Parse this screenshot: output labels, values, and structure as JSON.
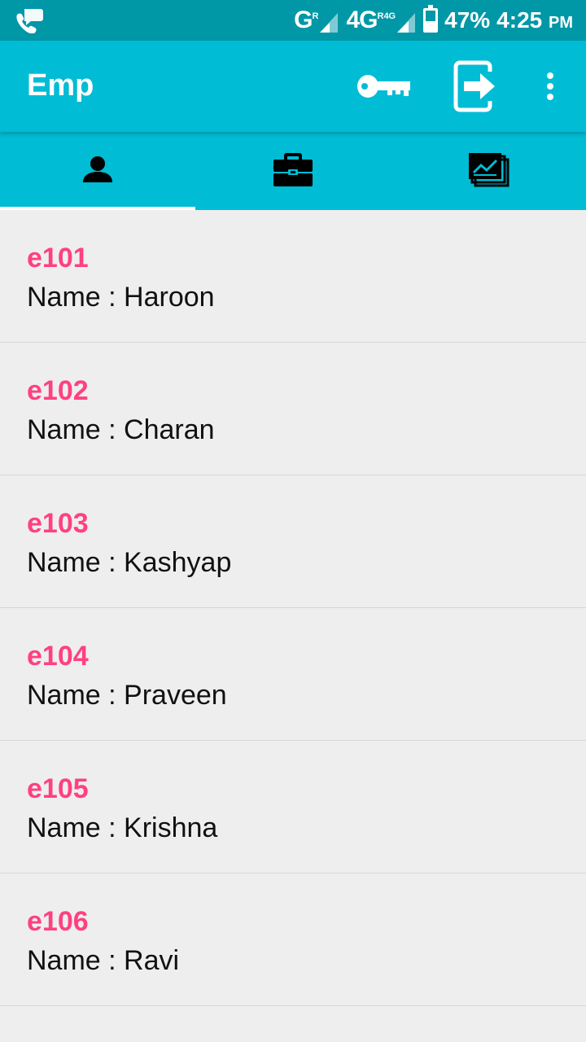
{
  "status_bar": {
    "left_icon": "phone-chat-icon",
    "network1": "G",
    "network1_sup": "R",
    "network2": "4G",
    "network2_sup": "R4G",
    "battery_level": 0.47,
    "battery": "47%",
    "time": "4:25",
    "ampm": "PM"
  },
  "app_bar": {
    "title": "Emp",
    "icons": [
      "key-icon",
      "exit-icon",
      "more-vert-icon"
    ]
  },
  "tabs": [
    {
      "icon": "person-icon",
      "active": true
    },
    {
      "icon": "briefcase-icon",
      "active": false
    },
    {
      "icon": "chart-stack-icon",
      "active": false
    }
  ],
  "colors": {
    "status_bar": "#0097a7",
    "app_bar": "#00bcd4",
    "accent": "#ff4081",
    "background": "#eeeeee"
  },
  "employees": [
    {
      "id": "e101",
      "name": "Name : Haroon"
    },
    {
      "id": "e102",
      "name": "Name : Charan"
    },
    {
      "id": "e103",
      "name": "Name : Kashyap"
    },
    {
      "id": "e104",
      "name": "Name : Praveen"
    },
    {
      "id": "e105",
      "name": "Name : Krishna"
    },
    {
      "id": "e106",
      "name": "Name : Ravi"
    }
  ]
}
